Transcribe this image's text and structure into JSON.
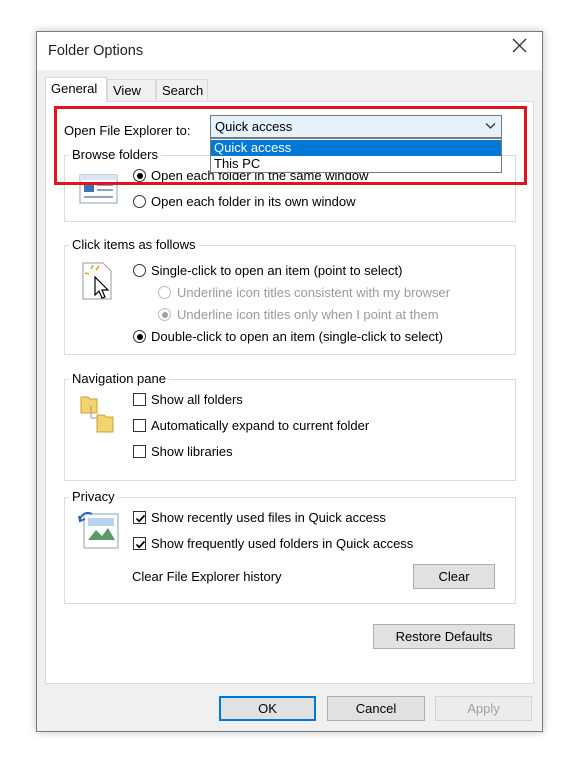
{
  "window": {
    "title": "Folder Options",
    "close_icon": "close-icon"
  },
  "tabs": [
    {
      "label": "General",
      "active": true
    },
    {
      "label": "View",
      "active": false
    },
    {
      "label": "Search",
      "active": false
    }
  ],
  "open_explorer": {
    "label": "Open File Explorer to:",
    "selected": "Quick access",
    "options": [
      "Quick access",
      "This PC"
    ],
    "highlighted_option": "Quick access"
  },
  "browse_folders": {
    "heading": "Browse folders",
    "options": [
      {
        "label": "Open each folder in the same window",
        "checked": true
      },
      {
        "label": "Open each folder in its own window",
        "checked": false
      }
    ]
  },
  "click_items": {
    "heading": "Click items as follows",
    "single_click": {
      "label": "Single-click to open an item (point to select)",
      "checked": false
    },
    "underline_consistent": {
      "label": "Underline icon titles consistent with my browser",
      "checked": false,
      "disabled": true
    },
    "underline_point": {
      "label": "Underline icon titles only when I point at them",
      "checked": true,
      "disabled": true
    },
    "double_click": {
      "label": "Double-click to open an item (single-click to select)",
      "checked": true
    }
  },
  "navigation_pane": {
    "heading": "Navigation pane",
    "options": [
      {
        "label": "Show all folders",
        "checked": false
      },
      {
        "label": "Automatically expand to current folder",
        "checked": false
      },
      {
        "label": "Show libraries",
        "checked": false
      }
    ]
  },
  "privacy": {
    "heading": "Privacy",
    "options": [
      {
        "label": "Show recently used files in Quick access",
        "checked": true
      },
      {
        "label": "Show frequently used folders in Quick access",
        "checked": true
      }
    ],
    "clear_label": "Clear File Explorer history",
    "clear_button": "Clear"
  },
  "restore_defaults": "Restore Defaults",
  "footer": {
    "ok": "OK",
    "cancel": "Cancel",
    "apply": "Apply"
  },
  "colors": {
    "accent": "#0078d7",
    "highlight_box": "#e0141f"
  }
}
